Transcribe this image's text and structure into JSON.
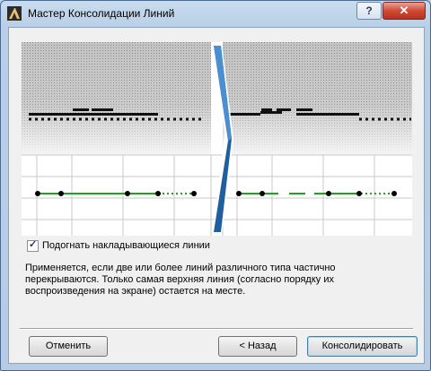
{
  "window": {
    "title": "Мастер Консолидации Линий"
  },
  "titlebar": {
    "help": "?",
    "close": "✕"
  },
  "option": {
    "label": "Подогнать накладывающиеся линии",
    "checked": true,
    "mark": "✓"
  },
  "description": "Применяется, если две или более линий различного типа частично перекрываются. Только самая верхняя линия (согласно порядку их воспроизведения на экране) остается на месте.",
  "buttons": {
    "cancel": "Отменить",
    "back": "< Назад",
    "consolidate": "Консолидировать"
  },
  "colors": {
    "accent_line": "#1aa51a",
    "arrow": "#1f5f9e"
  }
}
